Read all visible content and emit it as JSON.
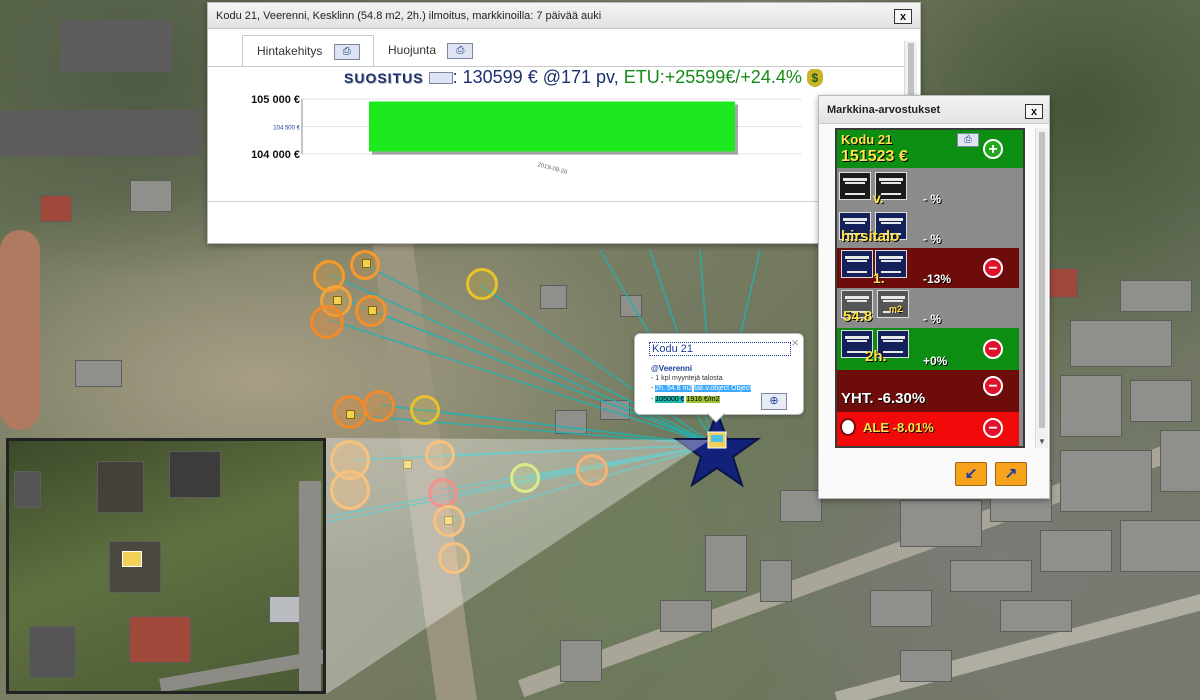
{
  "listing_window": {
    "title": "Kodu 21, Veerenni, Kesklinn (54.8 m2, 2h.) ilmoitus, markkinoilla: 7 päivää auki",
    "close_label": "x",
    "tabs": [
      {
        "label": "Hintakehitys",
        "active": true
      },
      {
        "label": "Huojunta",
        "active": false
      }
    ],
    "recommendation": {
      "label": "SUOSITUS",
      "colon": ":",
      "price_text": "130599 € @171 pv",
      "separator": ",",
      "gain_text": "ETU:+25599€/+24.4%",
      "money_icon": "money-bag-icon"
    }
  },
  "chart_data": {
    "type": "bar",
    "categories": [
      "2019-08-26"
    ],
    "values": [
      104500
    ],
    "y_tick_labels": [
      "105 000 €",
      "104 500 €",
      "104 000 €"
    ],
    "ylim": [
      104000,
      105000
    ],
    "bar_color": "#1ee91e",
    "title": "",
    "xlabel": "",
    "ylabel": ""
  },
  "market_panel": {
    "title": "Markkina-arvostukset",
    "close_label": "x",
    "header": {
      "name": "Kodu 21",
      "value": "151523 €",
      "add_label": "+"
    },
    "rows": [
      {
        "label": "v.",
        "pct": "- %",
        "bg": "#8b8b8b"
      },
      {
        "label": "hirsitalo",
        "pct": "- %",
        "bg": "#8b8b8b"
      },
      {
        "label": "1.",
        "pct": "-13%",
        "bg": "#6e0b0b",
        "button": "−"
      },
      {
        "label": "54.8",
        "sup": "m2",
        "pct": "- %",
        "bg": "#8b8b8b"
      },
      {
        "label": "2h.",
        "pct": "+0%",
        "bg": "#0c8e12",
        "button": "−"
      }
    ],
    "total": {
      "label": "YHT. -6.30%",
      "bg": "#6e0b0b",
      "button": "−"
    },
    "discount": {
      "label": "ALE -8.01%",
      "bg": "#f20a0a",
      "button": "−"
    },
    "footer_buttons": [
      {
        "name": "collapse-button",
        "glyph": "↙"
      },
      {
        "name": "expand-button",
        "glyph": "↗"
      }
    ]
  },
  "info_bubble": {
    "title": "Kodu 21",
    "close_label": "×",
    "user": "@Veerenni",
    "line1": "- 1 kpl myyntejä talosta",
    "line2_prefix": "- ",
    "line2_area": "2h. 54.8 m2",
    "line2_object": "tak.v.object Object",
    "line3_prefix": "- ",
    "line3_price": "105000 €",
    "line3_sqm": "1916 €/m2",
    "zoom_icon": "zoom-in-icon"
  },
  "colors": {
    "chart_bar": "#1ee91e",
    "price_text": "#1a2f6e",
    "gain_text": "#168a16",
    "panel_green": "#0c8e12",
    "panel_darkred": "#6e0b0b",
    "panel_red": "#f20a0a",
    "orange_button": "#f6a21b"
  }
}
